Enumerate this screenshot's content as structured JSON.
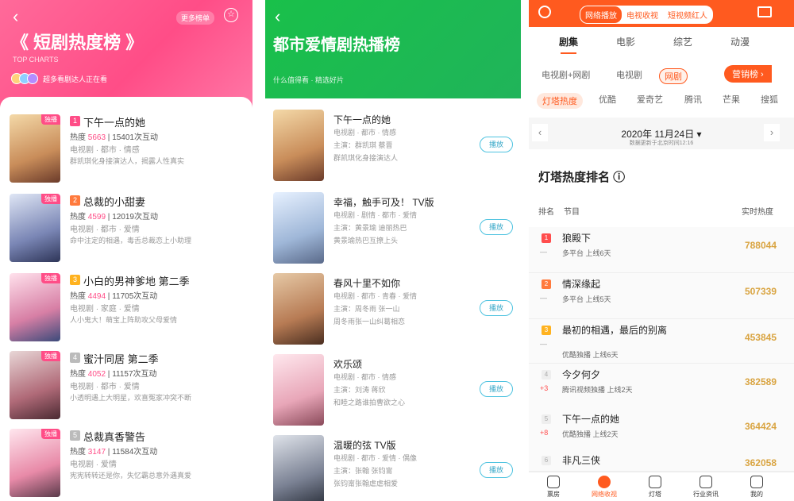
{
  "panel1": {
    "back": "‹",
    "hint": "更多榜单",
    "title": "《 短剧热度榜 》",
    "subtitle": "TOP CHARTS",
    "users_text": "超多看剧达人正在看",
    "items": [
      {
        "rank": "1",
        "name": "下午一点的她",
        "heat_label": "热度",
        "heat": "5663",
        "interact": "15401次互动",
        "category": "电视剧 · 都市 · 情感",
        "desc": "群凯琪化身接演达人，揭露人性真实",
        "badge": "独播",
        "rank_color": "#ff4d87"
      },
      {
        "rank": "2",
        "name": "总裁的小甜妻",
        "heat_label": "热度",
        "heat": "4599",
        "interact": "12019次互动",
        "category": "电视剧 · 都市 · 爱情",
        "desc": "命中注定的相遇，毒舌总裁恋上小助理",
        "badge": "独播",
        "rank_color": "#ff7a3d"
      },
      {
        "rank": "3",
        "name": "小白的男神爹地 第二季",
        "heat_label": "热度",
        "heat": "4494",
        "interact": "11705次互动",
        "category": "电视剧 · 家庭 · 爱情",
        "desc": "人小鬼大！萌宝上阵助攻父母爱情",
        "badge": "独播",
        "rank_color": "#ffb21f"
      },
      {
        "rank": "4",
        "name": "蜜汁同居 第二季",
        "heat_label": "热度",
        "heat": "4052",
        "interact": "11157次互动",
        "category": "电视剧 · 都市 · 爱情",
        "desc": "小透明遇上大明星，欢喜冤家冲突不断",
        "badge": "独播",
        "rank_color": "#bbbbbb"
      },
      {
        "rank": "5",
        "name": "总裁真香警告",
        "heat_label": "热度",
        "heat": "3147",
        "interact": "11584次互动",
        "category": "电视剧 · 爱情",
        "desc": "宪宪转转还是你，失忆霸总意外遇真爱",
        "badge": "独播",
        "rank_color": "#bbbbbb"
      }
    ]
  },
  "panel2": {
    "back": "‹",
    "title": "都市爱情剧热播榜",
    "subtitle": "什么值得看 · 精选好片",
    "btn": "播放",
    "items": [
      {
        "name": "下午一点的她",
        "l1": "电视剧 · 都市 · 情感",
        "l2": "主演：群凯琪 蔡晋",
        "l3": "群凯琪化身接演达人"
      },
      {
        "name": "幸福，触手可及！ TV版",
        "l1": "电视剧 · 剧情 · 都市 · 爱情",
        "l2": "主演：黄景瑜 迪丽热巴",
        "l3": "黄景瑜热巴互撩上头"
      },
      {
        "name": "春风十里不如你",
        "l1": "电视剧 · 都市 · 青春 · 爱情",
        "l2": "主演：周冬雨 张一山",
        "l3": "周冬雨张一山纠葛相恋"
      },
      {
        "name": "欢乐颂",
        "l1": "电视剧 · 都市 · 情感",
        "l2": "主演：刘涛 蒋欣",
        "l3": "和睦之路谁拍曹欲之心"
      },
      {
        "name": "温暖的弦 TV版",
        "l1": "电视剧 · 都市 · 爱情 · 偶像",
        "l2": "主演：张翰 张钧甯",
        "l3": "张钧甯张翰虐虐相爱"
      }
    ]
  },
  "panel3": {
    "top_tabs": [
      "网络播放",
      "电视收视",
      "短视频红人"
    ],
    "cats": [
      "剧集",
      "电影",
      "综艺",
      "动漫"
    ],
    "subs": [
      "电视剧+网剧",
      "电视剧",
      "网剧"
    ],
    "promo": "营销榜 ›",
    "platforms": [
      "灯塔热度",
      "优酷",
      "爱奇艺",
      "腾讯",
      "芒果",
      "搜狐"
    ],
    "date": "2020年 11月24日 ▾",
    "date_note": "数据更新于北京时间12:16",
    "heading": "灯塔热度排名 ⓘ",
    "col_rank": "排名",
    "col_show": "节目",
    "col_heat": "实时热度",
    "rows": [
      {
        "rank": "1",
        "change": "—",
        "name": "狼殿下",
        "meta": "多平台 上线6天",
        "val": "788044",
        "rc": "#ff4d4d",
        "cc": "#999"
      },
      {
        "rank": "2",
        "change": "—",
        "name": "情深缘起",
        "meta": "多平台 上线5天",
        "val": "507339",
        "rc": "#ff7a3d",
        "cc": "#999"
      },
      {
        "rank": "3",
        "change": "—",
        "name": "最初的相遇，最后的别离",
        "meta": "优酷独播 上线6天",
        "val": "453845",
        "rc": "#ffb21f",
        "cc": "#999"
      },
      {
        "rank": "4",
        "change": "+3",
        "name": "今夕何夕",
        "meta": "腾讯视频独播 上线2天",
        "val": "382589",
        "rc": "#ddd",
        "cc": "#ff4d4d"
      },
      {
        "rank": "5",
        "change": "+8",
        "name": "下午一点的她",
        "meta": "优酷独播 上线2天",
        "val": "364424",
        "rc": "#ddd",
        "cc": "#ff4d4d"
      },
      {
        "rank": "6",
        "change": "",
        "name": "非凡三侠",
        "meta": "",
        "val": "362058",
        "rc": "#ddd",
        "cc": "#999"
      }
    ],
    "nav": [
      "票房",
      "网络收视",
      "灯塔",
      "行业资讯",
      "我的"
    ]
  }
}
